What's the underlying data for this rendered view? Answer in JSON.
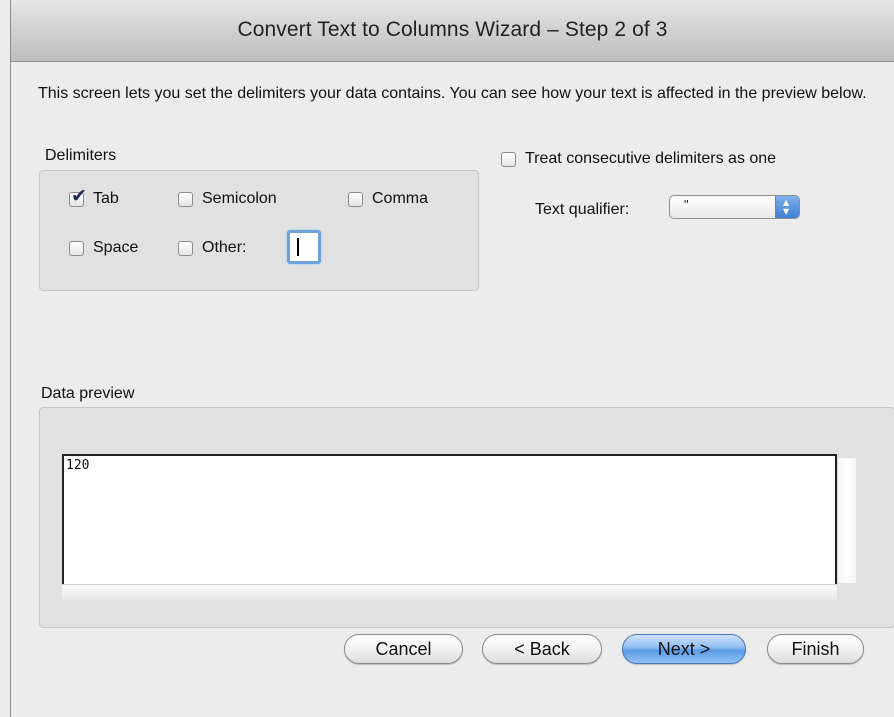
{
  "window": {
    "title": "Convert Text to Columns Wizard – Step 2 of 3"
  },
  "intro_text": "This screen lets you set the delimiters your data contains.  You can see how your text is affected in the preview below.",
  "delimiters": {
    "label": "Delimiters",
    "options": [
      {
        "label": "Tab",
        "checked": true
      },
      {
        "label": "Semicolon",
        "checked": false
      },
      {
        "label": "Comma",
        "checked": false
      },
      {
        "label": "Space",
        "checked": false
      },
      {
        "label": "Other:",
        "checked": false
      }
    ],
    "other_value": ""
  },
  "consecutive": {
    "label": "Treat consecutive delimiters as one",
    "checked": false
  },
  "qualifier": {
    "label": "Text qualifier:",
    "value": "\""
  },
  "preview": {
    "label": "Data preview",
    "rows": [
      "120"
    ]
  },
  "buttons": {
    "cancel": "Cancel",
    "back": "< Back",
    "next": "Next >",
    "finish": "Finish"
  },
  "icons": {
    "checkmark": "checkmark-icon",
    "popup_arrows": "up-down-arrows-icon"
  },
  "colors": {
    "default_button": "#5b9ae6",
    "focus_ring": "#6fa0e0",
    "checkmark": "#1d2a58"
  }
}
